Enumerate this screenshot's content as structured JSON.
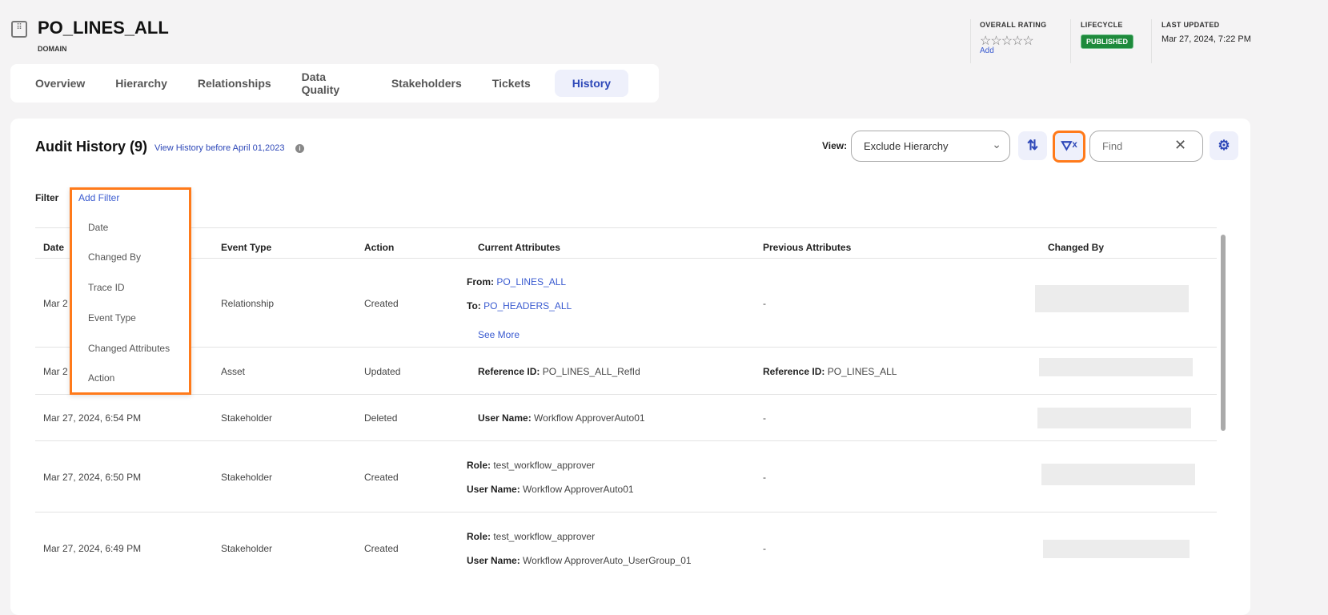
{
  "header": {
    "title": "PO_LINES_ALL",
    "type": "DOMAIN",
    "rating_label": "OVERALL RATING",
    "rating_value": 0,
    "rating_max": 5,
    "rating_add": "Add",
    "lifecycle_label": "LIFECYCLE",
    "lifecycle": "PUBLISHED",
    "updated_label": "LAST UPDATED",
    "updated": "Mar 27, 2024, 7:22 PM"
  },
  "tabs": [
    {
      "label": "Overview"
    },
    {
      "label": "Hierarchy"
    },
    {
      "label": "Relationships"
    },
    {
      "label": "Data Quality"
    },
    {
      "label": "Stakeholders"
    },
    {
      "label": "Tickets"
    },
    {
      "label": "History",
      "active": true
    }
  ],
  "audit": {
    "title": "Audit History (9)",
    "view_history_link": "View History before April 01,2023",
    "view_label": "View:",
    "view_value": "Exclude Hierarchy",
    "find_placeholder": "Find",
    "filter_label": "Filter",
    "add_filter": "Add Filter"
  },
  "filter_menu": [
    "Date",
    "Changed By",
    "Trace ID",
    "Event Type",
    "Changed Attributes",
    "Action"
  ],
  "columns": [
    "Date",
    "Event Type",
    "Action",
    "Current Attributes",
    "Previous Attributes",
    "Changed By"
  ],
  "rows": [
    {
      "date": "Mar 2",
      "event": "Relationship",
      "action": "Created",
      "current": [
        {
          "k": "From:",
          "v": "PO_LINES_ALL",
          "link": true
        },
        {
          "k": "To:",
          "v": "PO_HEADERS_ALL",
          "link": true
        }
      ],
      "see_more": "See More",
      "previous": "-"
    },
    {
      "date": "Mar 2",
      "event": "Asset",
      "action": "Updated",
      "current": [
        {
          "k": "Reference ID:",
          "v": "PO_LINES_ALL_RefId"
        }
      ],
      "previous_k": "Reference ID:",
      "previous": "PO_LINES_ALL"
    },
    {
      "date": "Mar 27, 2024, 6:54 PM",
      "event": "Stakeholder",
      "action": "Deleted",
      "current": [
        {
          "k": "User Name:",
          "v": "Workflow ApproverAuto01"
        }
      ],
      "previous": "-"
    },
    {
      "date": "Mar 27, 2024, 6:50 PM",
      "event": "Stakeholder",
      "action": "Created",
      "current": [
        {
          "k": "Role:",
          "v": "test_workflow_approver"
        },
        {
          "k": "User Name:",
          "v": "Workflow ApproverAuto01"
        }
      ],
      "previous": "-"
    },
    {
      "date": "Mar 27, 2024, 6:49 PM",
      "event": "Stakeholder",
      "action": "Created",
      "current": [
        {
          "k": "Role:",
          "v": "test_workflow_approver"
        },
        {
          "k": "User Name:",
          "v": "Workflow ApproverAuto_UserGroup_01"
        }
      ],
      "previous": "-"
    }
  ],
  "colors": {
    "accent": "#2e48b8",
    "published": "#1e8a3c",
    "highlight": "#ff7a1a"
  }
}
